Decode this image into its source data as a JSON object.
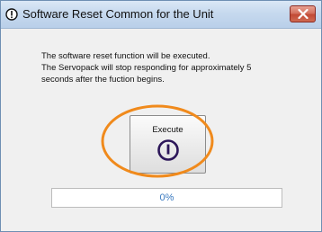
{
  "window": {
    "title": "Software Reset Common for the Unit"
  },
  "message": {
    "lines": [
      "The software reset function will be executed.",
      "The Servopack will stop responding for approximately 5",
      "seconds after the fuction begins."
    ]
  },
  "execute_button": {
    "label": "Execute",
    "icon": "power-icon"
  },
  "progress": {
    "value": 0,
    "text": "0%"
  },
  "colors": {
    "highlight_ring": "#f08a1c",
    "power_icon": "#2c1659",
    "progress_text": "#3a7ac0"
  },
  "icons": {
    "title": "info-icon",
    "close": "close-icon"
  }
}
